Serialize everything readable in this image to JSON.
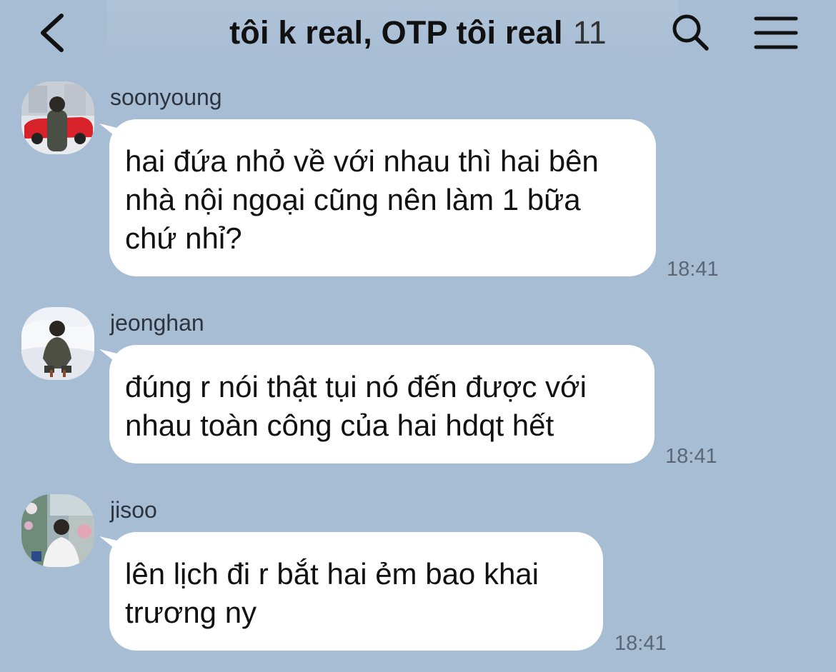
{
  "header": {
    "title": "tôi k real, OTP tôi real",
    "member_count": "11",
    "back_icon": "chevron-left-icon",
    "search_icon": "search-icon",
    "menu_icon": "hamburger-menu-icon"
  },
  "messages": [
    {
      "sender": "soonyoung",
      "lines": [
        "hai đứa nhỏ về với nhau thì hai bên",
        "nhà nội ngoại cũng nên làm 1 bữa",
        "chứ nhỉ?"
      ],
      "time": "18:41"
    },
    {
      "sender": "jeonghan",
      "lines": [
        "đúng r nói thật tụi nó đến được với",
        "nhau toàn công của hai hdqt hết"
      ],
      "time": "18:41"
    },
    {
      "sender": "jisoo",
      "lines": [
        "lên lịch đi r bắt hai ẻm bao khai",
        "trương ny"
      ],
      "time": "18:41"
    }
  ],
  "colors": {
    "background": "#a7bdd4",
    "bubble": "#ffffff",
    "text": "#111111",
    "timestamp": "#5a6777"
  }
}
